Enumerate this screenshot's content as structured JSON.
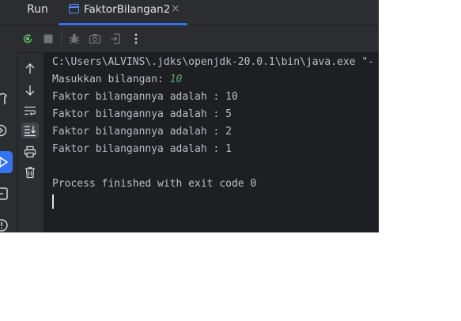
{
  "tabbar": {
    "run_label": "Run",
    "tab_title": "FaktorBilangan2",
    "close_glyph": "×"
  },
  "toolbar": {
    "icons": [
      "rerun-icon",
      "stop-icon",
      "debug-icon",
      "screenshot-icon",
      "exit-icon",
      "more-icon"
    ]
  },
  "left_strip": {
    "icons": [
      "build-icon",
      "services-icon",
      "run-icon",
      "terminal-icon",
      "problems-icon"
    ]
  },
  "gutter": {
    "icons": [
      "up-arrow-icon",
      "down-arrow-icon",
      "soft-wrap-icon",
      "scroll-to-end-icon",
      "print-icon",
      "trash-icon"
    ]
  },
  "console": {
    "command": "C:\\Users\\ALVINS\\.jdks\\openjdk-20.0.1\\bin\\java.exe \"-",
    "prompt": "Masukkan bilangan: ",
    "input_value": "10",
    "outputs": [
      "Faktor bilangannya adalah : 10",
      "Faktor bilangannya adalah : 5",
      "Faktor bilangannya adalah : 2",
      "Faktor bilangannya adalah : 1"
    ],
    "exit_message": "Process finished with exit code 0"
  },
  "colors": {
    "accent": "#3574f0",
    "console_bg": "#1e1f22",
    "panel_bg": "#2b2d30",
    "text": "#bcbec4",
    "input_text": "#5ea56f",
    "rerun_green": "#5fb865"
  }
}
